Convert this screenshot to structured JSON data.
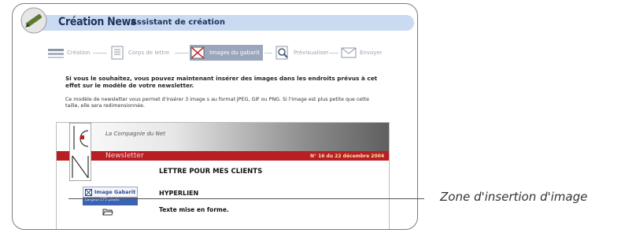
{
  "app": {
    "name": "Création News",
    "subtitle": "Assistant de création"
  },
  "steps": [
    {
      "label": "Création",
      "icon": "creation-icon"
    },
    {
      "label": "Corps de lettre",
      "icon": "document-icon"
    },
    {
      "label": "Images du gabarit",
      "icon": "image-icon",
      "active": true
    },
    {
      "label": "Prévisualiser",
      "icon": "magnifier-icon"
    },
    {
      "label": "Envoyer",
      "icon": "envelope-icon"
    }
  ],
  "intro": {
    "bold": "Si vous le souhaitez, vous pouvez maintenant insérer des images dans les endroits prévus à cet effet sur le modèle de votre newsletter.",
    "note": "Ce modèle de newsletter vous permet d'insérer 3 image s au format JPEG, GIF ou PNG. Si l'image est plus petite que cette taille, elle sera redimensionnée."
  },
  "newsletter": {
    "company": "La Compagnie du Net",
    "label": "Newsletter",
    "issue": "N° 16 du 22 décembre 2004",
    "title": "LETTRE POUR MES CLIENTS",
    "hyperlink": "HYPERLIEN",
    "body": "Texte mise en forme.",
    "image_button": "Image Gabarit",
    "image_width_label": "Largeur",
    "image_width_value": "175 pixels"
  },
  "callout": "Zone d'insertion d'image"
}
